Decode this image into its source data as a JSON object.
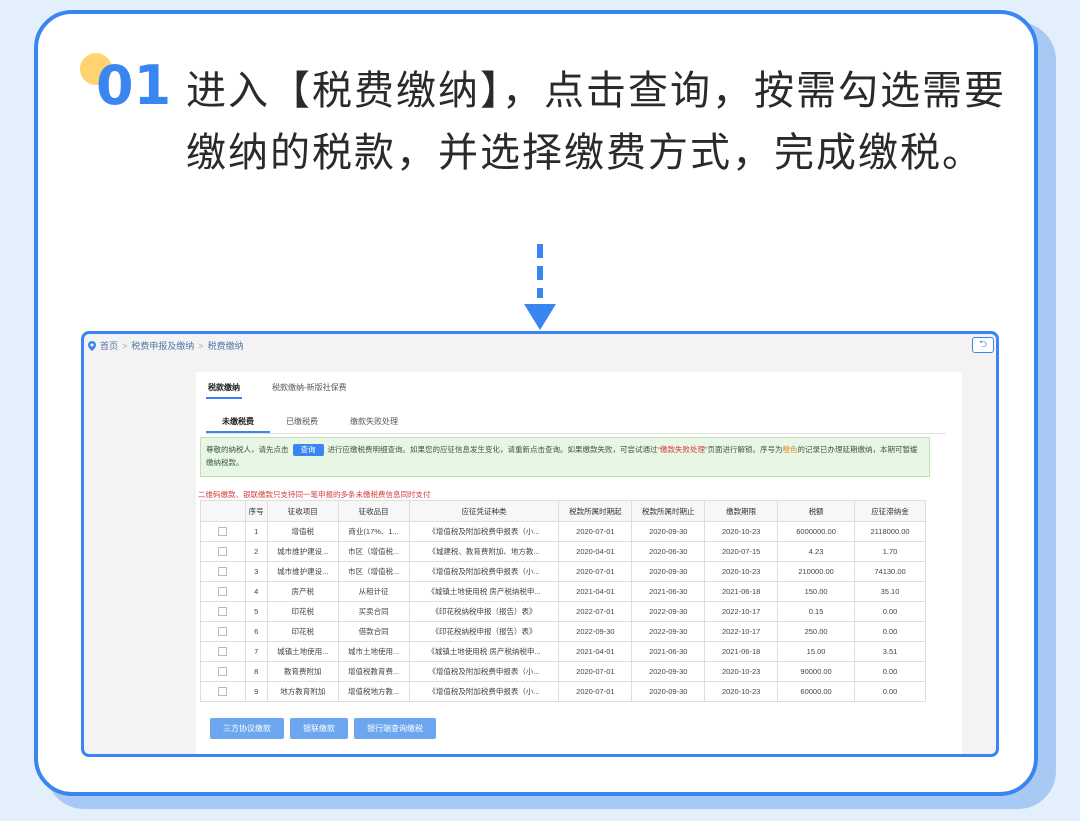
{
  "step": {
    "number": "01",
    "text": "进入【税费缴纳】，点击查询，按需勾选需要缴纳的税款，并选择缴费方式，完成缴税。"
  },
  "screen": {
    "breadcrumb": [
      "首页",
      "税费申报及缴纳",
      "税费缴纳"
    ],
    "back_icon": "return-icon",
    "tabs_top": [
      {
        "label": "税款缴纳",
        "active": true
      },
      {
        "label": "税款缴纳-新版社保费",
        "active": false
      }
    ],
    "tabs_sub": [
      {
        "label": "未缴税费",
        "active": true
      },
      {
        "label": "已缴税费",
        "active": false
      },
      {
        "label": "缴款失败处理",
        "active": false
      }
    ],
    "notice": {
      "prefix": "尊敬的纳税人，请先点击",
      "query_label": "查询",
      "middle": "进行应缴税费明细查询。如果您的应征信息发生变化，请重新点击查询。如果缴款失败，可尝试通过",
      "red_text": "“缴款失败处理”",
      "after_red": "页面进行解锁。序号为",
      "orange_text": "橙色",
      "suffix": "的记录已办理延期缴纳，本期可暂缓缴纳税款。"
    },
    "red_note": "二维码缴款、银联缴款只支持同一笔申报的多条未缴税费信息同时支付",
    "table": {
      "headers": [
        "",
        "序号",
        "征收项目",
        "征收品目",
        "应征凭证种类",
        "税款所属时期起",
        "税款所属时期止",
        "缴款期限",
        "税额",
        "应征滞纳金"
      ],
      "rows": [
        [
          "1",
          "增值税",
          "商业(17%、1...",
          "《增值税及附加税费申报表（小...",
          "2020-07-01",
          "2020-09-30",
          "2020-10-23",
          "6000000.00",
          "2118000.00"
        ],
        [
          "2",
          "城市维护建设...",
          "市区（增值税...",
          "《城建税、教育费附加、地方教...",
          "2020-04-01",
          "2020-06-30",
          "2020-07-15",
          "4.23",
          "1.70"
        ],
        [
          "3",
          "城市维护建设...",
          "市区（增值税...",
          "《增值税及附加税费申报表（小...",
          "2020-07-01",
          "2020-09-30",
          "2020-10-23",
          "210000.00",
          "74130.00"
        ],
        [
          "4",
          "房产税",
          "从租计征",
          "《城镇土地使用税 房产税纳税申...",
          "2021-04-01",
          "2021-06-30",
          "2021-06-18",
          "150.00",
          "35.10"
        ],
        [
          "5",
          "印花税",
          "买卖合同",
          "《印花税纳税申报（报告）表》",
          "2022-07-01",
          "2022-09-30",
          "2022-10-17",
          "0.15",
          "0.00"
        ],
        [
          "6",
          "印花税",
          "借款合同",
          "《印花税纳税申报（报告）表》",
          "2022-09-30",
          "2022-09-30",
          "2022-10-17",
          "250.00",
          "0.00"
        ],
        [
          "7",
          "城镇土地使用...",
          "城市土地使用...",
          "《城镇土地使用税 房产税纳税申...",
          "2021-04-01",
          "2021-06-30",
          "2021-06-18",
          "15.00",
          "3.51"
        ],
        [
          "8",
          "教育费附加",
          "增值税教育费...",
          "《增值税及附加税费申报表（小...",
          "2020-07-01",
          "2020-09-30",
          "2020-10-23",
          "90000.00",
          "0.00"
        ],
        [
          "9",
          "地方教育附加",
          "增值税地方教...",
          "《增值税及附加税费申报表（小...",
          "2020-07-01",
          "2020-09-30",
          "2020-10-23",
          "60000.00",
          "0.00"
        ]
      ]
    },
    "actions": [
      "三方协议缴款",
      "银联缴款",
      "银行端查询缴税"
    ]
  }
}
